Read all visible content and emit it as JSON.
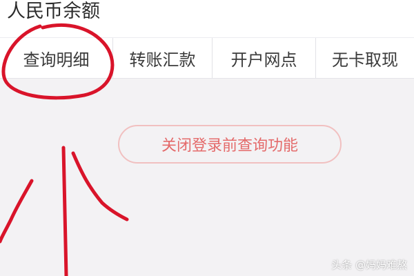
{
  "balance": {
    "title": "人民币余额"
  },
  "tabs": [
    {
      "label": "查询明细"
    },
    {
      "label": "转账汇款"
    },
    {
      "label": "开户网点"
    },
    {
      "label": "无卡取现"
    }
  ],
  "actions": {
    "close_prelogin_query": "关闭登录前查询功能"
  },
  "annotation": {
    "color": "#d9142a",
    "highlighted_tab": "查询明细"
  },
  "watermark": "头条 @妈妈难熬",
  "colors": {
    "page_bg": "#f3f2f4",
    "button_text": "#e46a6a",
    "button_border": "#f1c0c0"
  }
}
